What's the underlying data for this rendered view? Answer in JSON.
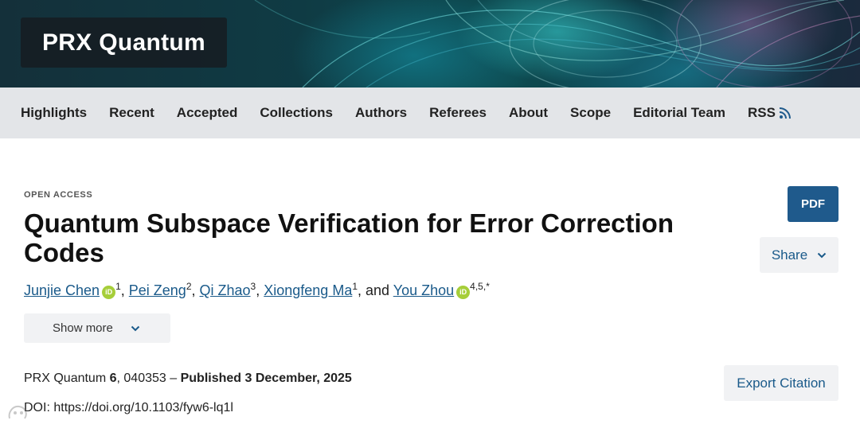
{
  "header": {
    "logo_text": "PRX Quantum"
  },
  "nav": {
    "items": [
      "Highlights",
      "Recent",
      "Accepted",
      "Collections",
      "Authors",
      "Referees",
      "About",
      "Scope",
      "Editorial Team",
      "RSS"
    ],
    "rss_icon": "rss-icon"
  },
  "article": {
    "eyebrow": "OPEN ACCESS",
    "title": "Quantum Subspace Verification for Error Correction Codes",
    "authors": [
      {
        "name": "Junjie Chen",
        "orcid": true,
        "affil": "1"
      },
      {
        "name": "Pei Zeng",
        "orcid": false,
        "affil": "2"
      },
      {
        "name": "Qi Zhao",
        "orcid": false,
        "affil": "3"
      },
      {
        "name": "Xiongfeng Ma",
        "orcid": false,
        "affil": "1"
      },
      {
        "name": "You Zhou",
        "orcid": true,
        "affil": "4,5,*"
      }
    ],
    "author_conjunction": "and",
    "orcid_label": "iD",
    "show_more_label": "Show more",
    "journal": "PRX Quantum",
    "volume": "6",
    "article_number": ", 040353 –",
    "published": "Published 3 December, 2025",
    "doi_label": "DOI:",
    "doi_url": "https://doi.org/10.1103/fyw6-lq1l"
  },
  "actions": {
    "pdf_label": "PDF",
    "share_label": "Share",
    "export_label": "Export Citation"
  },
  "colors": {
    "accent": "#1f5a8c",
    "link": "#1a5a8a",
    "nav_bg": "#e3e5e8",
    "orcid": "#a6ce39"
  }
}
